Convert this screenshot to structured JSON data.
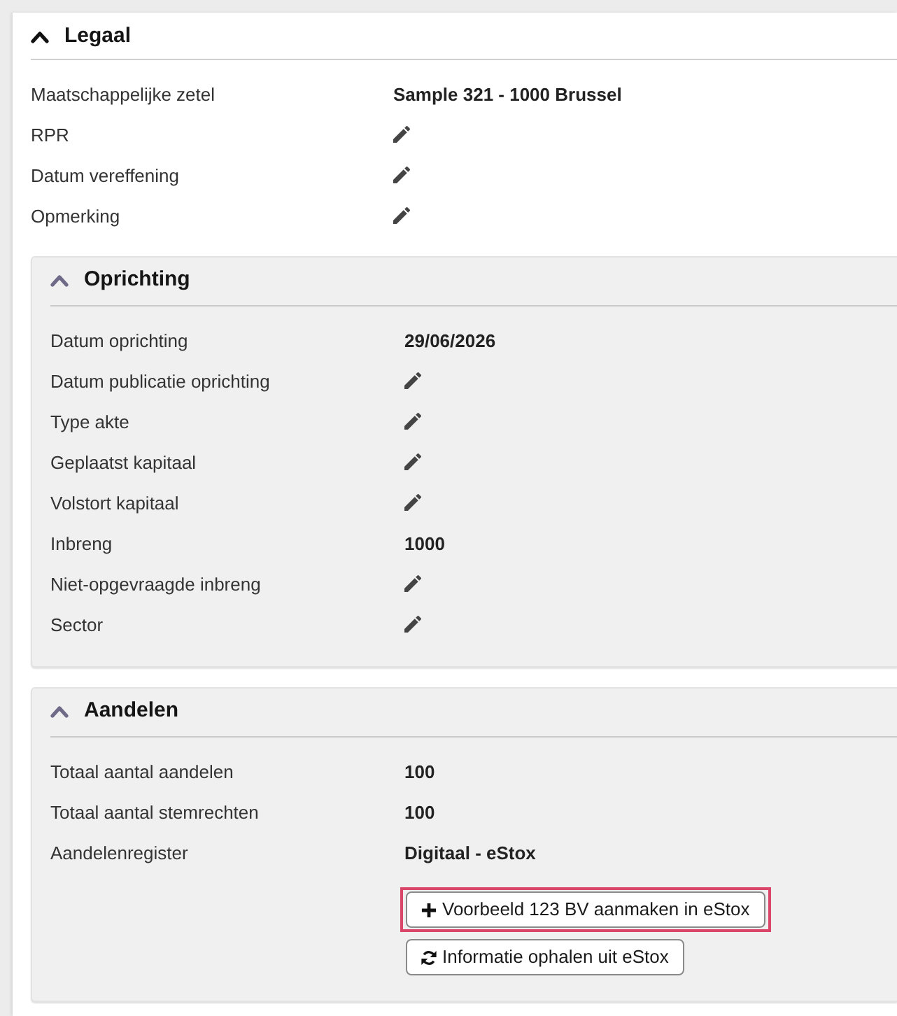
{
  "sections": [
    {
      "title": "Legaal",
      "expanded": true,
      "rows": [
        {
          "label": "Maatschappelijke zetel",
          "kind": "text",
          "value": "Sample 321 - 1000 Brussel"
        },
        {
          "label": "RPR",
          "kind": "edit"
        },
        {
          "label": "Datum vereffening",
          "kind": "edit"
        },
        {
          "label": "Opmerking",
          "kind": "edit"
        }
      ],
      "children": [
        {
          "title": "Oprichting",
          "expanded": true,
          "rows": [
            {
              "label": "Datum oprichting",
              "kind": "text",
              "value": "29/06/2026"
            },
            {
              "label": "Datum publicatie oprichting",
              "kind": "edit"
            },
            {
              "label": "Type akte",
              "kind": "edit"
            },
            {
              "label": "Geplaatst kapitaal",
              "kind": "edit"
            },
            {
              "label": "Volstort kapitaal",
              "kind": "edit"
            },
            {
              "label": "Inbreng",
              "kind": "text",
              "value": "1000"
            },
            {
              "label": "Niet-opgevraagde inbreng",
              "kind": "edit"
            },
            {
              "label": "Sector",
              "kind": "edit"
            }
          ]
        },
        {
          "title": "Aandelen",
          "expanded": true,
          "rows": [
            {
              "label": "Totaal aantal aandelen",
              "kind": "text",
              "value": "100"
            },
            {
              "label": "Totaal aantal stemrechten",
              "kind": "text",
              "value": "100"
            },
            {
              "label": "Aandelenregister",
              "kind": "text",
              "value": "Digitaal - eStox"
            }
          ],
          "buttons": [
            {
              "label": "Voorbeeld 123 BV aanmaken in eStox",
              "kind": "add",
              "highlighted": true
            },
            {
              "label": "Informatie ophalen uit eStox",
              "kind": "sync",
              "highlighted": false
            }
          ]
        }
      ]
    }
  ]
}
